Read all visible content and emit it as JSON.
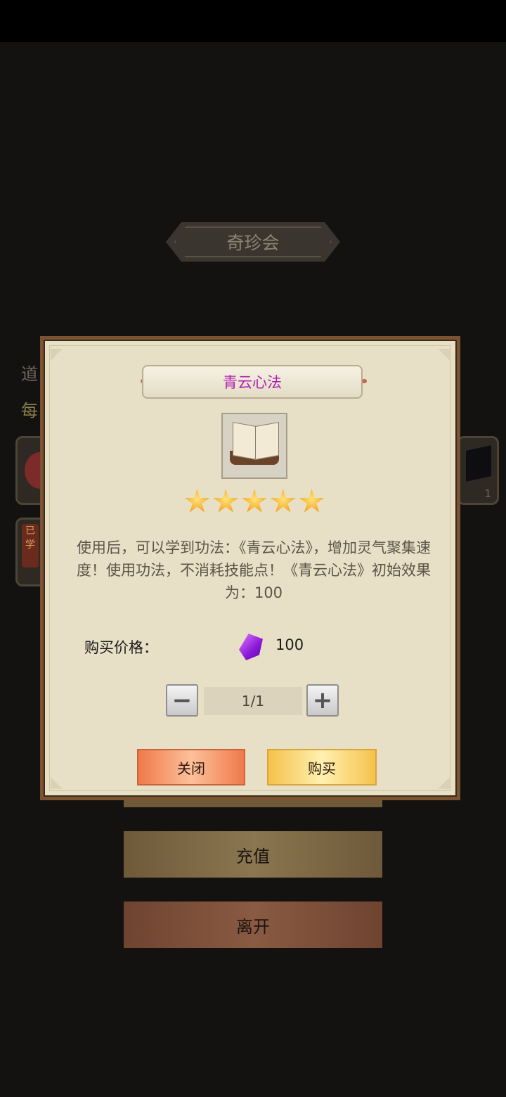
{
  "screen": {
    "title": "奇珍会",
    "side_text_1": "道",
    "side_text_2": "每",
    "slot_tag": "已学",
    "slot_count": "1",
    "recharge_label": "充值",
    "leave_label": "离开"
  },
  "dialog": {
    "item_name": "青云心法",
    "item_icon": "book-icon",
    "stars": 5,
    "description": "使用后，可以学到功法：《青云心法》，增加灵气聚集速度！使用功法，不消耗技能点！《青云心法》初始效果为：100",
    "price_label": "购买价格：",
    "currency_icon": "purple-gem-icon",
    "price_value": "100",
    "quantity": "1/1",
    "minus_label": "−",
    "plus_label": "+",
    "close_label": "关闭",
    "buy_label": "购买"
  },
  "colors": {
    "item_name": "#b020b0",
    "close_button": "#f07a4a",
    "buy_button": "#f6c24a",
    "dialog_bg": "#e8e0c6"
  }
}
